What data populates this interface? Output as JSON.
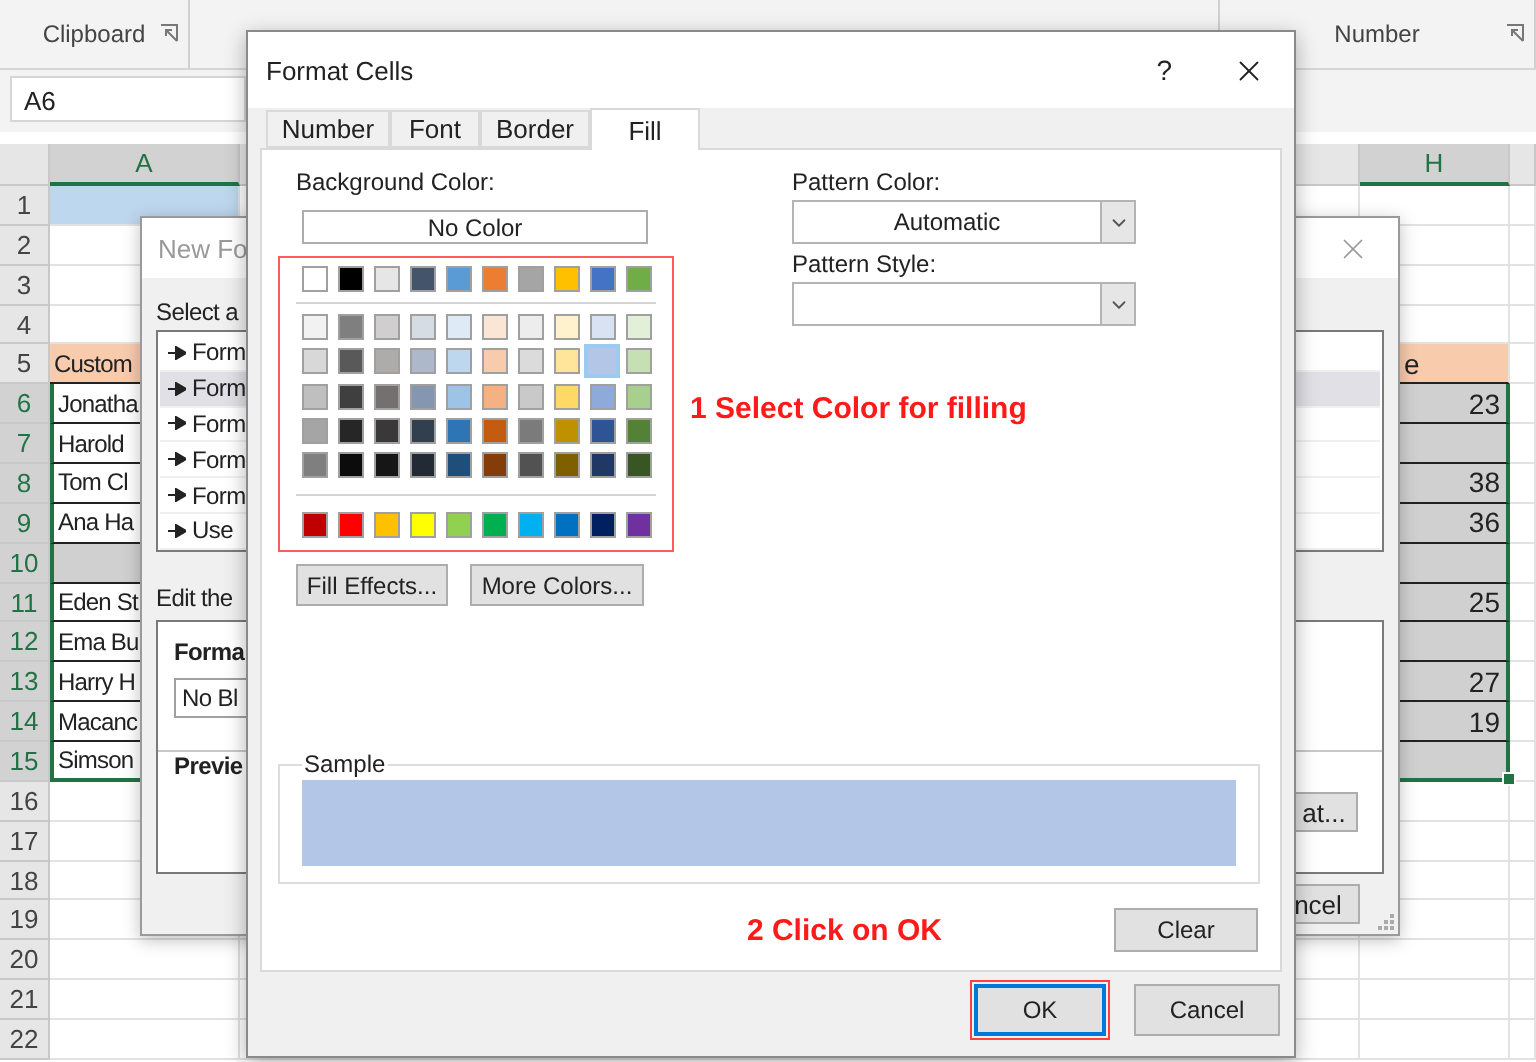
{
  "ribbon": {
    "groups": [
      "Clipboard",
      "Number"
    ]
  },
  "name_box": "A6",
  "columns": [
    {
      "label": "A",
      "selected": true
    },
    {
      "label": "H",
      "selected": true
    }
  ],
  "rows": [
    {
      "number": "1",
      "kind": "title",
      "selected": false
    },
    {
      "number": "2",
      "kind": "empty",
      "selected": false
    },
    {
      "number": "3",
      "kind": "empty",
      "selected": false
    },
    {
      "number": "4",
      "kind": "empty",
      "selected": false
    },
    {
      "number": "5",
      "kind": "header",
      "selected": false,
      "a": "Custom",
      "h": "e"
    },
    {
      "number": "6",
      "kind": "data",
      "selected": true,
      "a": "Jonatha",
      "h": "23"
    },
    {
      "number": "7",
      "kind": "data",
      "selected": true,
      "a": "Harold"
    },
    {
      "number": "8",
      "kind": "data",
      "selected": true,
      "a": "Tom Cl",
      "h": "38"
    },
    {
      "number": "9",
      "kind": "data",
      "selected": true,
      "a": "Ana Ha",
      "h": "36"
    },
    {
      "number": "10",
      "kind": "gap",
      "selected": true
    },
    {
      "number": "11",
      "kind": "data",
      "selected": true,
      "a": "Eden St",
      "h": "25"
    },
    {
      "number": "12",
      "kind": "data",
      "selected": true,
      "a": "Ema Bu"
    },
    {
      "number": "13",
      "kind": "data",
      "selected": true,
      "a": "Harry H",
      "h": "27"
    },
    {
      "number": "14",
      "kind": "data",
      "selected": true,
      "a": "Macanc",
      "h": "19"
    },
    {
      "number": "15",
      "kind": "data",
      "selected": true,
      "a": "Simson"
    },
    {
      "number": "16",
      "kind": "empty",
      "selected": false
    },
    {
      "number": "17",
      "kind": "empty",
      "selected": false
    },
    {
      "number": "18",
      "kind": "empty",
      "selected": false
    },
    {
      "number": "19",
      "kind": "empty",
      "selected": false
    },
    {
      "number": "20",
      "kind": "empty",
      "selected": false
    },
    {
      "number": "21",
      "kind": "empty",
      "selected": false
    },
    {
      "number": "22",
      "kind": "empty",
      "selected": false
    }
  ],
  "new_rule_dialog": {
    "title": "New Fo",
    "select_label": "Select a",
    "rules": [
      {
        "label": "Form",
        "selected": false
      },
      {
        "label": "Form",
        "selected": true
      },
      {
        "label": "Form",
        "selected": false
      },
      {
        "label": "Form",
        "selected": false
      },
      {
        "label": "Form",
        "selected": false
      },
      {
        "label": "Use",
        "selected": false
      }
    ],
    "edit_label": "Edit the",
    "format_label": "Forma",
    "format_field": "No Bl",
    "preview_label": "Previe",
    "format_button": "at...",
    "cancel_button": "ncel"
  },
  "format_cells": {
    "title": "Format Cells",
    "help": "?",
    "tabs": [
      {
        "label": "Number",
        "selected": false
      },
      {
        "label": "Font",
        "selected": false
      },
      {
        "label": "Border",
        "selected": false
      },
      {
        "label": "Fill",
        "selected": true
      }
    ],
    "background_label": "Background Color:",
    "no_color": "No Color",
    "palette": {
      "theme": [
        {
          "color": "#ffffff",
          "selected": false
        },
        {
          "color": "#000000",
          "selected": false
        },
        {
          "color": "#e7e6e6",
          "selected": false
        },
        {
          "color": "#44546a",
          "selected": false
        },
        {
          "color": "#5b9bd5",
          "selected": false
        },
        {
          "color": "#ed7d31",
          "selected": false
        },
        {
          "color": "#a5a5a5",
          "selected": false
        },
        {
          "color": "#ffc000",
          "selected": false
        },
        {
          "color": "#4472c4",
          "selected": false
        },
        {
          "color": "#70ad47",
          "selected": false
        }
      ],
      "tints": [
        [
          {
            "color": "#f2f2f2",
            "selected": false
          },
          {
            "color": "#7f7f7f",
            "selected": false
          },
          {
            "color": "#d0cece",
            "selected": false
          },
          {
            "color": "#d6dce4",
            "selected": false
          },
          {
            "color": "#deebf6",
            "selected": false
          },
          {
            "color": "#fbe5d5",
            "selected": false
          },
          {
            "color": "#ededed",
            "selected": false
          },
          {
            "color": "#fff2cc",
            "selected": false
          },
          {
            "color": "#d9e2f3",
            "selected": false
          },
          {
            "color": "#e2efd9",
            "selected": false
          }
        ],
        [
          {
            "color": "#d8d8d8",
            "selected": false
          },
          {
            "color": "#595959",
            "selected": false
          },
          {
            "color": "#aeabab",
            "selected": false
          },
          {
            "color": "#adb9ca",
            "selected": false
          },
          {
            "color": "#bdd7ee",
            "selected": false
          },
          {
            "color": "#f7cbac",
            "selected": false
          },
          {
            "color": "#dbdbdb",
            "selected": false
          },
          {
            "color": "#fee599",
            "selected": false
          },
          {
            "color": "#b4c6e7",
            "selected": true
          },
          {
            "color": "#c5e0b3",
            "selected": false
          }
        ],
        [
          {
            "color": "#bfbfbf",
            "selected": false
          },
          {
            "color": "#3f3f3f",
            "selected": false
          },
          {
            "color": "#757070",
            "selected": false
          },
          {
            "color": "#8496b0",
            "selected": false
          },
          {
            "color": "#9dc3e6",
            "selected": false
          },
          {
            "color": "#f4b183",
            "selected": false
          },
          {
            "color": "#c9c9c9",
            "selected": false
          },
          {
            "color": "#ffd965",
            "selected": false
          },
          {
            "color": "#8eaadb",
            "selected": false
          },
          {
            "color": "#a8d08d",
            "selected": false
          }
        ],
        [
          {
            "color": "#a5a5a5",
            "selected": false
          },
          {
            "color": "#262626",
            "selected": false
          },
          {
            "color": "#3a3838",
            "selected": false
          },
          {
            "color": "#323f4f",
            "selected": false
          },
          {
            "color": "#2e75b5",
            "selected": false
          },
          {
            "color": "#c55a11",
            "selected": false
          },
          {
            "color": "#7b7b7b",
            "selected": false
          },
          {
            "color": "#bf9000",
            "selected": false
          },
          {
            "color": "#2f5496",
            "selected": false
          },
          {
            "color": "#538135",
            "selected": false
          }
        ],
        [
          {
            "color": "#7f7f7f",
            "selected": false
          },
          {
            "color": "#0c0c0c",
            "selected": false
          },
          {
            "color": "#171616",
            "selected": false
          },
          {
            "color": "#222a35",
            "selected": false
          },
          {
            "color": "#1e4e79",
            "selected": false
          },
          {
            "color": "#843c0b",
            "selected": false
          },
          {
            "color": "#525252",
            "selected": false
          },
          {
            "color": "#7f6000",
            "selected": false
          },
          {
            "color": "#1f3864",
            "selected": false
          },
          {
            "color": "#375623",
            "selected": false
          }
        ]
      ],
      "standard": [
        {
          "color": "#c00000",
          "selected": false
        },
        {
          "color": "#ff0000",
          "selected": false
        },
        {
          "color": "#ffc000",
          "selected": false
        },
        {
          "color": "#ffff00",
          "selected": false
        },
        {
          "color": "#92d050",
          "selected": false
        },
        {
          "color": "#00b050",
          "selected": false
        },
        {
          "color": "#00b0f0",
          "selected": false
        },
        {
          "color": "#0070c0",
          "selected": false
        },
        {
          "color": "#002060",
          "selected": false
        },
        {
          "color": "#7030a0",
          "selected": false
        }
      ]
    },
    "fill_effects": "Fill Effects...",
    "more_colors": "More Colors...",
    "pattern_color_label": "Pattern Color:",
    "pattern_color": "Automatic",
    "pattern_style_label": "Pattern Style:",
    "sample_label": "Sample",
    "clear": "Clear",
    "ok": "OK",
    "cancel": "Cancel"
  },
  "annotations": {
    "select_color": "1 Select Color for filling",
    "click_ok": "2 Click on OK"
  }
}
